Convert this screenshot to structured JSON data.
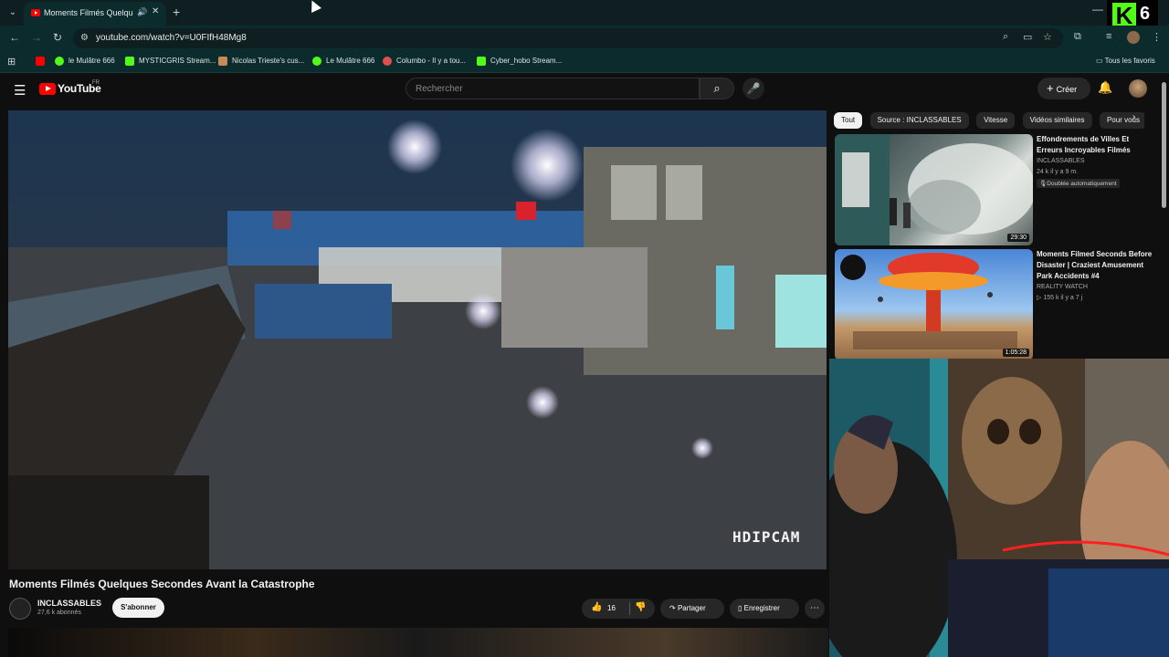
{
  "browser": {
    "tab_title": "Moments Filmés Quelques",
    "url": "youtube.com/watch?v=U0FIfH48Mg8",
    "bookmarks": [
      "le Mulâtre 666",
      "MYSTICGRIS Stream...",
      "Nicolas Trieste's cus...",
      "Le Mulâtre 666",
      "Columbo - Il y a tou...",
      "Cyber_hobo Stream..."
    ],
    "bookmarks_all": "Tous les favoris",
    "overlay_count": "6"
  },
  "youtube": {
    "logo_text": "YouTube",
    "region": "FR",
    "search_placeholder": "Rechercher",
    "create_label": "Créer"
  },
  "video": {
    "watermark": "HDIPCAM",
    "title": "Moments Filmés Quelques Secondes Avant la Catastrophe",
    "channel": "INCLASSABLES",
    "subscribers": "27,6 k abonnés",
    "subscribe_label": "S'abonner",
    "likes": "16",
    "share_label": "Partager",
    "save_label": "Enregistrer"
  },
  "chips": [
    "Tout",
    "Source : INCLASSABLES",
    "Vitesse",
    "Vidéos similaires",
    "Pour vous"
  ],
  "related": [
    {
      "title": "Effondrements de Villes Et Erreurs Incroyables Filmés",
      "channel": "INCLASSABLES",
      "meta": "24 k  il y a 9 m.",
      "badge": "Doublée automatiquement",
      "duration": "29:30"
    },
    {
      "title": "Moments Filmed Seconds Before Disaster | Craziest Amusement Park Accidents #4",
      "channel": "REALITY WATCH",
      "meta": "▷ 155 k  il y a 7 j",
      "duration": "1:05:28"
    }
  ],
  "colors": {
    "brand_red": "#ff0000",
    "kick_green": "#53fc18",
    "chrome_bg": "#0b2b2c"
  },
  "icons": [
    "search-icon",
    "mic-icon",
    "bell-icon",
    "like-icon",
    "dislike-icon",
    "share-icon",
    "save-icon",
    "more-icon"
  ]
}
